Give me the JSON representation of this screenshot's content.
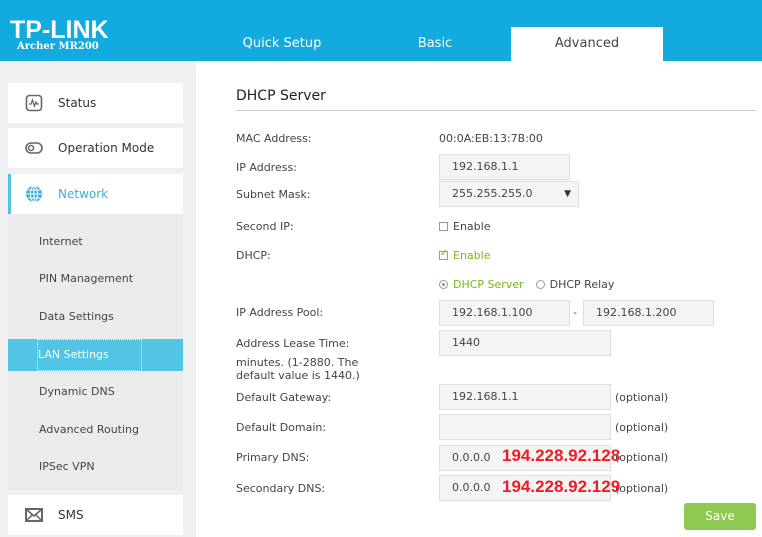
{
  "header": {
    "brand": "TP-LINK",
    "model": "Archer MR200",
    "tabs": [
      {
        "label": "Quick Setup"
      },
      {
        "label": "Basic"
      },
      {
        "label": "Advanced",
        "active": true
      }
    ]
  },
  "sidebar": {
    "items": [
      {
        "label": "Status",
        "icon": "status-icon"
      },
      {
        "label": "Operation Mode",
        "icon": "operation-mode-icon"
      },
      {
        "label": "Network",
        "icon": "globe-icon",
        "active": true
      },
      {
        "label": "SMS",
        "icon": "envelope-icon"
      }
    ],
    "sub_items": [
      {
        "label": "Internet"
      },
      {
        "label": "PIN Management"
      },
      {
        "label": "Data Settings"
      },
      {
        "label": "LAN Settings",
        "active": true
      },
      {
        "label": "Dynamic DNS"
      },
      {
        "label": "Advanced Routing"
      },
      {
        "label": "IPSec VPN"
      }
    ]
  },
  "main": {
    "title": "DHCP Server",
    "mac_label": "MAC Address:",
    "mac_value": "00:0A:EB:13:7B:00",
    "ip_label": "IP Address:",
    "ip_value": "192.168.1.1",
    "subnet_label": "Subnet Mask:",
    "subnet_value": "255.255.255.0",
    "second_ip_label": "Second IP:",
    "second_ip_option": "Enable",
    "second_ip_checked": false,
    "dhcp_label": "DHCP:",
    "dhcp_option": "Enable",
    "dhcp_checked": true,
    "mode_server": "DHCP Server",
    "mode_relay": "DHCP Relay",
    "mode_selected": "DHCP Server",
    "pool_label": "IP Address Pool:",
    "pool_start": "192.168.1.100",
    "pool_sep": "-",
    "pool_end": "192.168.1.200",
    "lease_label": "Address Lease Time:",
    "lease_value": "1440",
    "lease_note1": "minutes. (1-2880. The",
    "lease_note2": "default value is 1440.)",
    "gateway_label": "Default Gateway:",
    "gateway_value": "192.168.1.1",
    "domain_label": "Default Domain:",
    "domain_value": "",
    "primary_dns_label": "Primary DNS:",
    "primary_dns_value": "0.0.0.0",
    "secondary_dns_label": "Secondary DNS:",
    "secondary_dns_value": "0.0.0.0",
    "optional": "(optional)",
    "annotation_primary": "194.228.92.128",
    "annotation_secondary": "194.228.92.129",
    "save_label": "Save"
  },
  "colors": {
    "header": "#12aadf",
    "accent": "#51c5e3",
    "save": "#91c852",
    "annotation": "#ee1c25",
    "enabled_green": "#7ab51d"
  }
}
